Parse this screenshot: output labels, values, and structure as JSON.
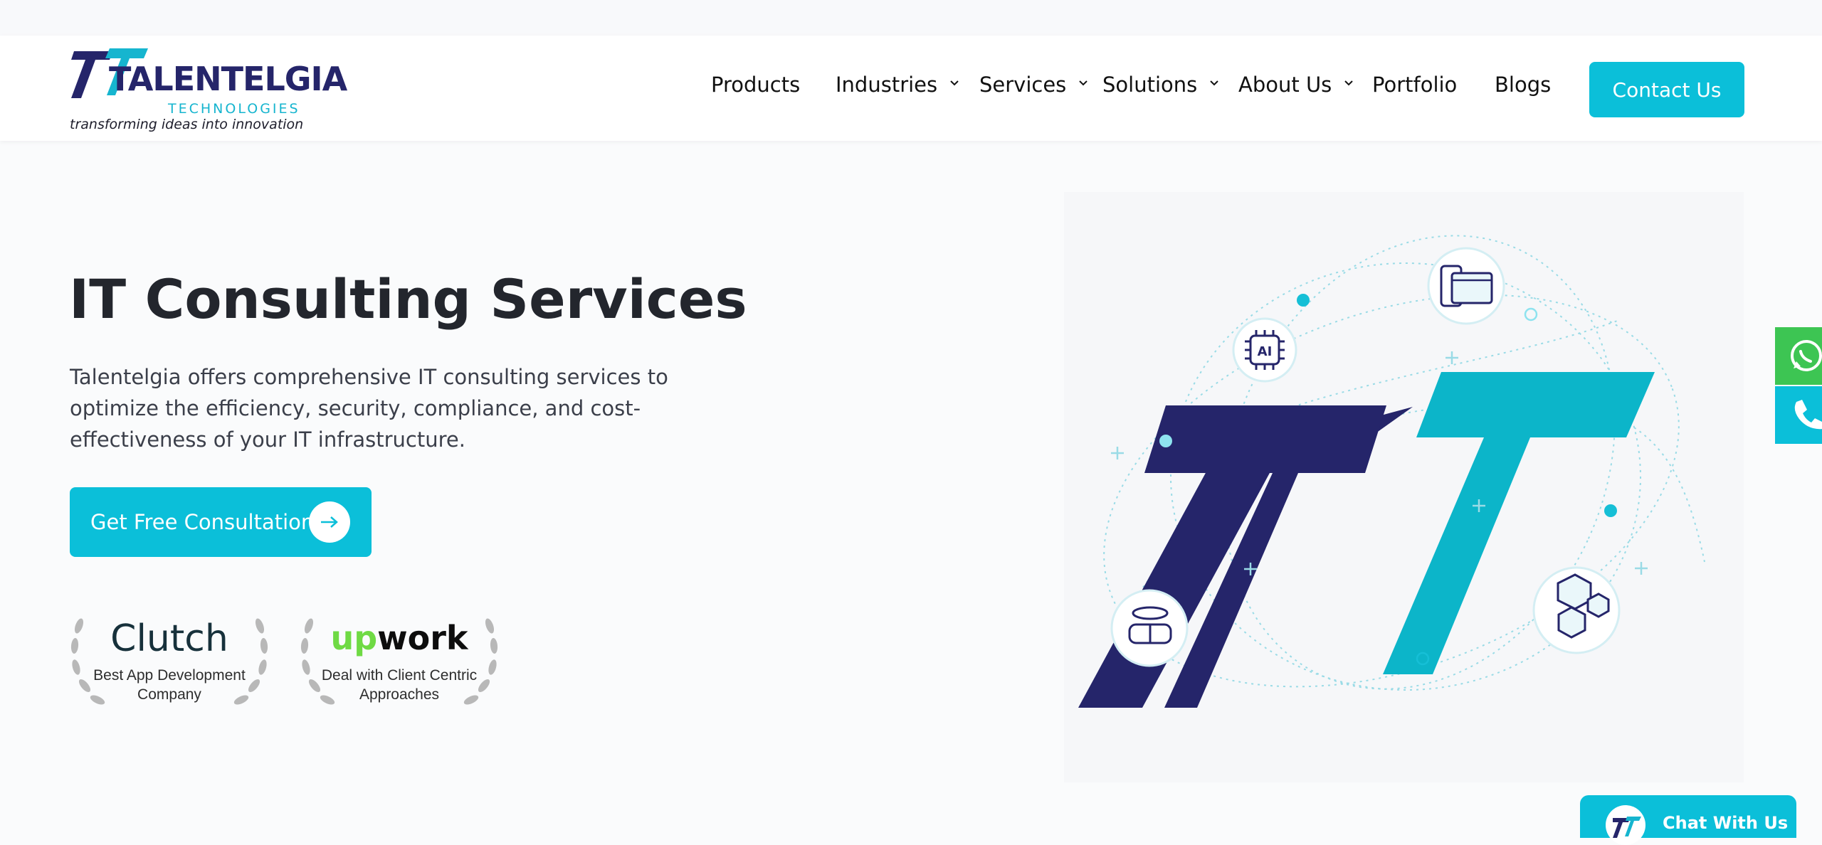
{
  "brand": {
    "name": "TALENTELGIA",
    "sub": "TECHNOLOGIES",
    "tagline": "transforming ideas into innovation",
    "colors": {
      "navy": "#25256a",
      "teal": "#0bbfd9"
    }
  },
  "nav": {
    "items": [
      {
        "label": "Products",
        "dropdown": false
      },
      {
        "label": "Industries",
        "dropdown": true
      },
      {
        "label": "Services",
        "dropdown": true
      },
      {
        "label": "Solutions",
        "dropdown": true
      },
      {
        "label": "About Us",
        "dropdown": true
      },
      {
        "label": "Portfolio",
        "dropdown": false
      },
      {
        "label": "Blogs",
        "dropdown": false
      }
    ],
    "contact_label": "Contact Us"
  },
  "hero": {
    "title": "IT Consulting Services",
    "description": "Talentelgia offers comprehensive IT consulting services to optimize the efficiency, security, compliance, and cost-effectiveness of your IT infrastructure.",
    "cta_label": "Get Free Consultation",
    "cta_icon": "arrow-right-icon"
  },
  "badges": [
    {
      "brand": "Clutch",
      "text_line1": "Best App Development",
      "text_line2": "Company"
    },
    {
      "brand_part1": "up",
      "brand_part2": "work",
      "text_line1": "Deal with Client Centric",
      "text_line2": "Approaches"
    }
  ],
  "illustration": {
    "icons": [
      "ai-chip-icon",
      "devices-icon",
      "vr-headset-icon",
      "cubes-icon"
    ],
    "chip_label": "AI"
  },
  "floating": {
    "whatsapp_icon": "whatsapp-icon",
    "phone_icon": "phone-icon",
    "chat_label": "Chat With Us"
  }
}
